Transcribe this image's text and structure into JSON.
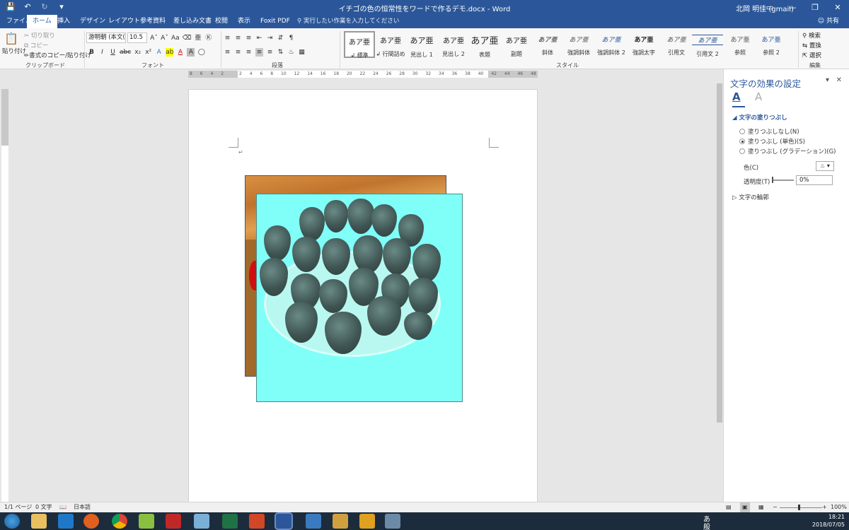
{
  "window": {
    "title": "イチゴの色の恒常性をワードで作るデモ.docx - Word",
    "user": "北岡 明佳 (gmail)",
    "qat_icons": [
      "save-icon",
      "undo-icon",
      "redo-icon",
      "customize-icon"
    ],
    "controls": [
      "ribbon-display-icon",
      "minimize-icon",
      "restore-icon",
      "close-icon"
    ]
  },
  "tabs": [
    "ファイル",
    "ホーム",
    "挿入",
    "デザイン",
    "レイアウト",
    "参考資料",
    "差し込み文書",
    "校閲",
    "表示",
    "Foxit PDF"
  ],
  "active_tab": "ホーム",
  "tellme": "実行したい作業を入力してください",
  "share": "共有",
  "clipboard": {
    "paste": "貼り付け",
    "cut": "切り取り",
    "copy": "コピー",
    "format_painter": "書式のコピー/貼り付け",
    "label": "クリップボード"
  },
  "font": {
    "name": "游明朝 (本文(",
    "size": "10.5",
    "label": "フォント"
  },
  "paragraph": {
    "label": "段落"
  },
  "styles": {
    "label": "スタイル",
    "preview": "あア亜",
    "items": [
      "↲ 標準",
      "↲ 行間詰め",
      "見出し 1",
      "見出し 2",
      "表題",
      "副題",
      "斜体",
      "強調斜体",
      "強調斜体 2",
      "強調太字",
      "引用文",
      "引用文 2",
      "参照",
      "参照 2"
    ]
  },
  "editing": {
    "find": "検索",
    "replace": "置換",
    "select": "選択",
    "label": "編集"
  },
  "ruler_nums": [
    "8",
    "6",
    "4",
    "2",
    "",
    "2",
    "4",
    "6",
    "8",
    "10",
    "12",
    "14",
    "16",
    "18",
    "20",
    "22",
    "24",
    "26",
    "28",
    "30",
    "32",
    "34",
    "36",
    "38",
    "40",
    "42",
    "44",
    "46",
    "48"
  ],
  "document": {
    "para_mark": "↵"
  },
  "pane": {
    "title": "文字の効果の設定",
    "fill_section": "文字の塗りつぶし",
    "opt_none": "塗りつぶしなし(N)",
    "opt_solid": "塗りつぶし (単色)(S)",
    "opt_gradient": "塗りつぶし (グラデーション)(G)",
    "color_label": "色(C)",
    "transparency_label": "透明度(T)",
    "transparency_value": "0%",
    "outline_section": "文字の輪郭"
  },
  "status": {
    "page": "1/1 ページ",
    "words": "0 文字",
    "lang": "日本語",
    "zoom": "100%"
  },
  "tray": {
    "time": "18:21",
    "date": "2018/07/05",
    "ime": "あ 般"
  },
  "colors": {
    "accent": "#2b579a",
    "fill": "#80fff8"
  }
}
